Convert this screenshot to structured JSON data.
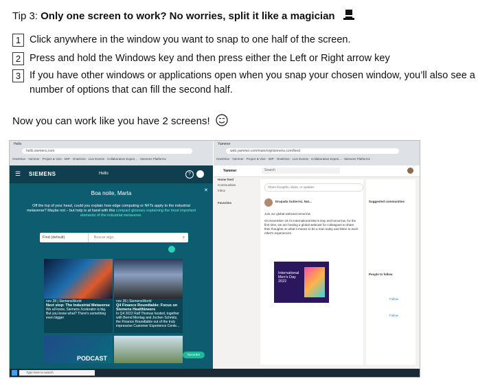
{
  "tip": {
    "prefix": "Tip 3: ",
    "heading": "Only one screen to work? No worries, split it like a magician"
  },
  "steps": [
    {
      "num": "1",
      "text": "Click anywhere in the window you want to snap to one half of the screen."
    },
    {
      "num": "2",
      "text": "Press and hold the Windows key and then press either the Left or Right arrow key"
    },
    {
      "num": "3",
      "text": "If you have other windows or applications open when you snap your chosen window, you’ll also see a number of options that can fill the second half."
    }
  ],
  "closing": "Now you can work like you have 2 screens!",
  "screenshot": {
    "left": {
      "tab_label": "Hello",
      "address": "hello.siemens.com",
      "logo": "SIEMENS",
      "app_name": "Hello",
      "greeting": "Boa noite, Marta",
      "intro": "Off the top of your head, could you explain how edge computing or NFTs apply to the industrial metaverse? Maybe not – but help is at hand with this",
      "intro_link": "compact glossary explaining the most important elements of the industrial metaverse.",
      "search_scope": "Find (default)",
      "search_placeholder": "Buscar algo",
      "cards": [
        {
          "date": "nov 28 | SiemensWorld",
          "title": "Next stop: The Industrial Metaverse",
          "body": "We all know, Siemens Xcelerator is big. But you know what? There's something even bigger"
        },
        {
          "date": "nov 28 | SiemensWorld",
          "title": "Q4 Finance Roundtable: Focus on Siemens Healthineers",
          "body": "In Q4 2022 Ralf Thomas hosted, together with Bernd Montag and Jochen Schmitz, the Finance Roundtable out of the truly impressive Customer Experience Cente..."
        }
      ],
      "podcast_label": "PODCAST",
      "button": "Recorder"
    },
    "right": {
      "tab_label": "Yammer",
      "address": "web.yammer.com/main/org/siemens.com/feed",
      "app_name": "Yammer",
      "search": "Search",
      "nav": [
        "Home feed",
        "Communities",
        "Inbox"
      ],
      "favorites_label": "Favorites",
      "post_placeholder": "Share thoughts, ideas, or updates",
      "post_author": "Drupada Gutierrez, Nat...",
      "post_title": "Join our global webcast tomorrow",
      "post_body": "On November 19 it's International Men's Day and tomorrow, for the first time, we are hosting a global webcast for colleagues to share their thoughts on what it means to be a man today and listen to each other's experiences.",
      "banner_line1": "International",
      "banner_line2": "Men's Day",
      "banner_year": "2022",
      "suggested": "Suggested communities",
      "people": "People to follow",
      "follow": "Follow"
    },
    "taskbar_search": "Type here to search"
  }
}
